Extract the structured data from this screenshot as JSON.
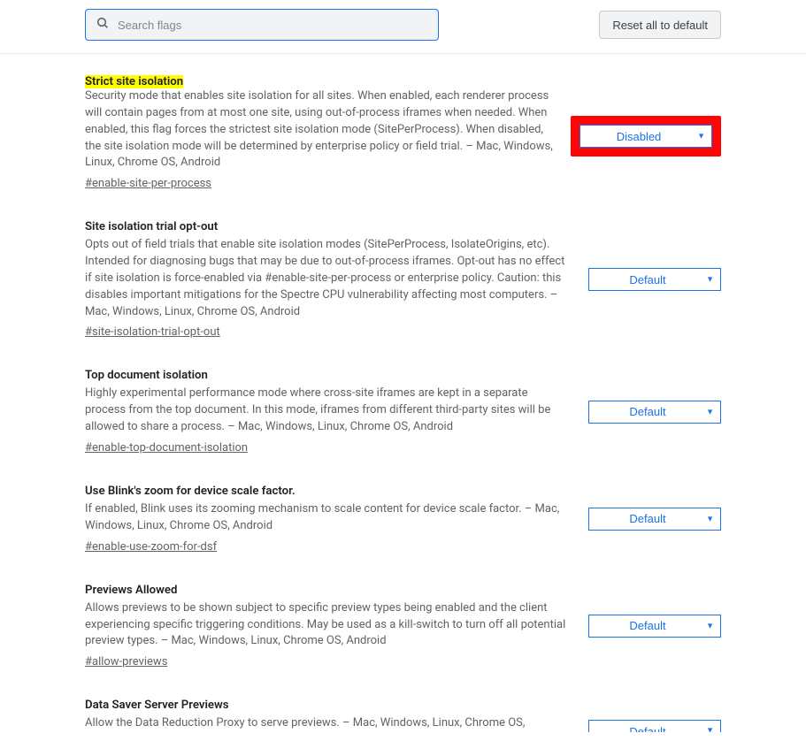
{
  "header": {
    "search_placeholder": "Search flags",
    "reset_label": "Reset all to default"
  },
  "flags": [
    {
      "title": "Strict site isolation",
      "highlighted": true,
      "desc": "Security mode that enables site isolation for all sites. When enabled, each renderer process will contain pages from at most one site, using out-of-process iframes when needed. When enabled, this flag forces the strictest site isolation mode (SitePerProcess). When disabled, the site isolation mode will be determined by enterprise policy or field trial. – Mac, Windows, Linux, Chrome OS, Android",
      "hash": "#enable-site-per-process",
      "value": "Disabled",
      "emphasized": true
    },
    {
      "title": "Site isolation trial opt-out",
      "desc": "Opts out of field trials that enable site isolation modes (SitePerProcess, IsolateOrigins, etc). Intended for diagnosing bugs that may be due to out-of-process iframes. Opt-out has no effect if site isolation is force-enabled via #enable-site-per-process or enterprise policy. Caution: this disables important mitigations for the Spectre CPU vulnerability affecting most computers. – Mac, Windows, Linux, Chrome OS, Android",
      "hash": "#site-isolation-trial-opt-out",
      "value": "Default"
    },
    {
      "title": "Top document isolation",
      "desc": "Highly experimental performance mode where cross-site iframes are kept in a separate process from the top document. In this mode, iframes from different third-party sites will be allowed to share a process. – Mac, Windows, Linux, Chrome OS, Android",
      "hash": "#enable-top-document-isolation",
      "value": "Default"
    },
    {
      "title": "Use Blink's zoom for device scale factor.",
      "desc": "If enabled, Blink uses its zooming mechanism to scale content for device scale factor. – Mac, Windows, Linux, Chrome OS, Android",
      "hash": "#enable-use-zoom-for-dsf",
      "value": "Default"
    },
    {
      "title": "Previews Allowed",
      "desc": "Allows previews to be shown subject to specific preview types being enabled and the client experiencing specific triggering conditions. May be used as a kill-switch to turn off all potential preview types. – Mac, Windows, Linux, Chrome OS, Android",
      "hash": "#allow-previews",
      "value": "Default"
    },
    {
      "title": "Data Saver Server Previews",
      "desc": "Allow the Data Reduction Proxy to serve previews. – Mac, Windows, Linux, Chrome OS,",
      "hash": "",
      "value": "Default"
    }
  ]
}
